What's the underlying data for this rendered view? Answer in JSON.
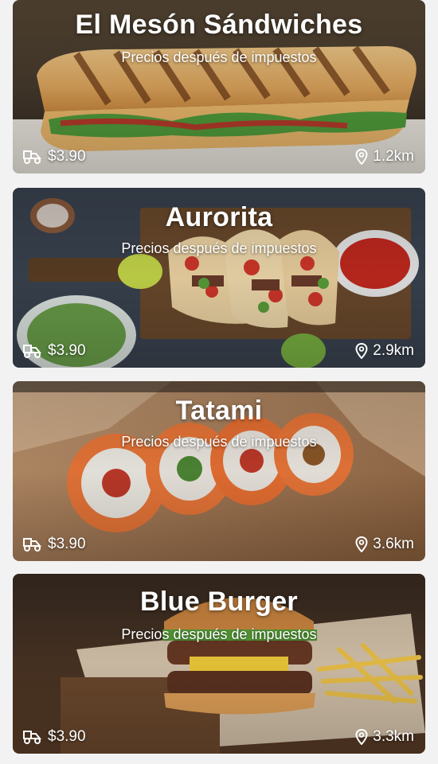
{
  "restaurants": [
    {
      "name": "El Mesón Sándwiches",
      "subtitle": "Precios después de impuestos",
      "price": "$3.90",
      "distance": "1.2km",
      "image": "sandwich-photo"
    },
    {
      "name": "Aurorita",
      "subtitle": "Precios después de impuestos",
      "price": "$3.90",
      "distance": "2.9km",
      "image": "tacos-photo"
    },
    {
      "name": "Tatami",
      "subtitle": "Precios después de impuestos",
      "price": "$3.90",
      "distance": "3.6km",
      "image": "sushi-photo"
    },
    {
      "name": "Blue Burger",
      "subtitle": "Precios después de impuestos",
      "price": "$3.90",
      "distance": "3.3km",
      "image": "burger-photo"
    }
  ],
  "icons": {
    "price": "delivery-scooter-icon",
    "distance": "location-pin-icon"
  },
  "colors": {
    "background": "#f2f2f2",
    "text": "#ffffff"
  }
}
